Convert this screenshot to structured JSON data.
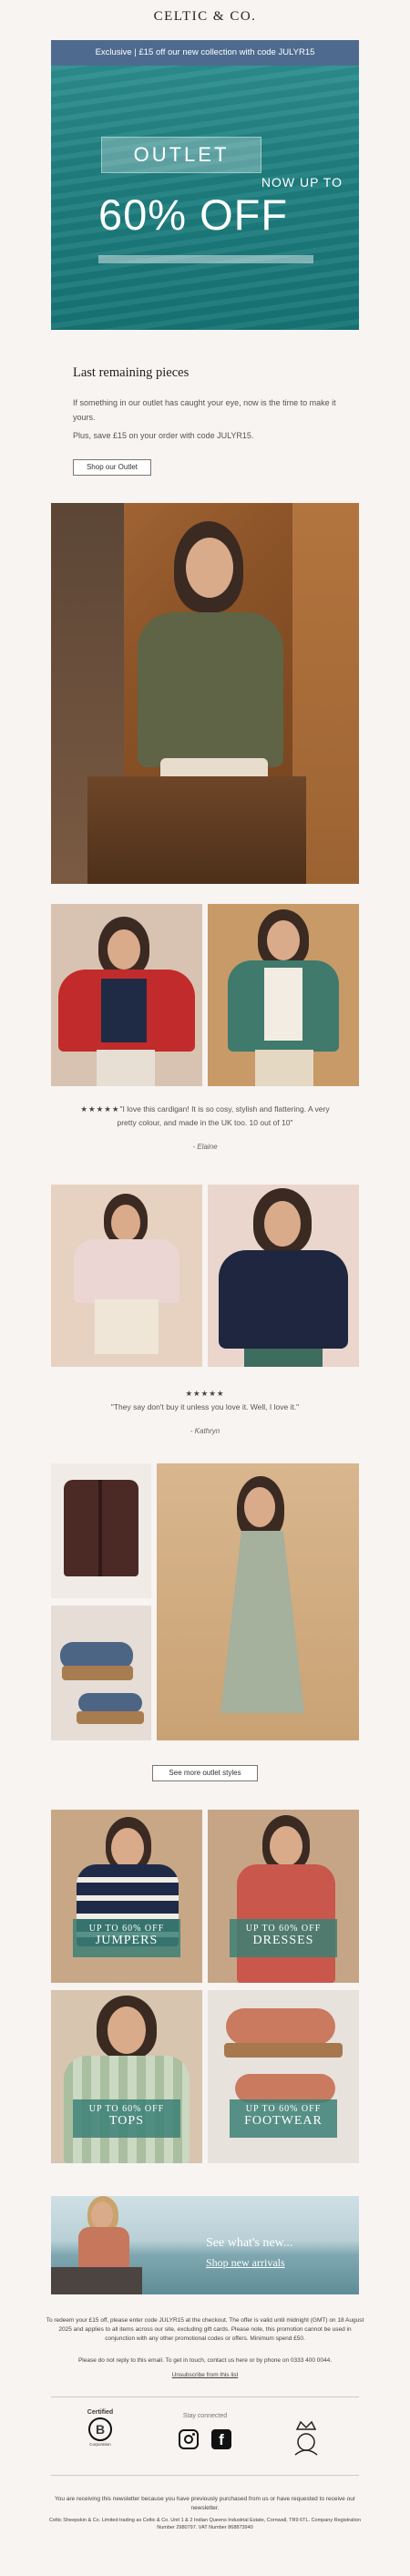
{
  "brand": {
    "logo": "CELTIC & CO."
  },
  "hero": {
    "banner": "Exclusive | £15 off our new collection with code JULYR15",
    "outlet": "OUTLET",
    "now_up_to": "NOW UP TO",
    "percent": "60% OFF"
  },
  "intro": {
    "title": "Last remaining pieces",
    "p1": "If something in our outlet has caught your eye, now is the time to make it yours.",
    "p2": "Plus, save £15 on your order with code JULYR15.",
    "button": "Shop our Outlet"
  },
  "review1": {
    "stars": "★★★★★",
    "text": "\"I love this cardigan! It is so cosy, stylish and flattering. A very pretty colour, and made in the UK too. 10 out of 10\"",
    "author": "- Elaine"
  },
  "review2": {
    "stars": "★★★★★",
    "text": "\"They say don't buy it unless you love it. Well, I love it.\"",
    "author": "- Kathryn"
  },
  "more_button": "See more outlet styles",
  "categories": [
    {
      "line1": "UP TO 60% OFF",
      "line2": "JUMPERS"
    },
    {
      "line1": "UP TO 60% OFF",
      "line2": "DRESSES"
    },
    {
      "line1": "UP TO 60% OFF",
      "line2": "TOPS"
    },
    {
      "line1": "UP TO 60% OFF",
      "line2": "FOOTWEAR"
    }
  ],
  "new_banner": {
    "line1": "See what's new...",
    "line2": "Shop new arrivals"
  },
  "footer": {
    "terms": "To redeem your £15 off, please enter code JULYR15 at the checkout. The offer is valid until midnight (GMT) on 18 August 2025 and applies to all items across our site, excluding gift cards. Please note, this promotion cannot be used in conjunction with any other promotional codes or offers. Minimum spend £50.",
    "reply": "Please do not reply to this email. To get in touch, contact us here or by phone on 0333 400 0044.",
    "unsubscribe": "Unsubscribe from this list",
    "certified_label": "Certified",
    "certified_sub": "Corporation",
    "stay_connected": "Stay connected",
    "receiving": "You are receiving this newsletter because you have previously purchased from us or have requested to receive our newsletter.",
    "legal": "Celtic Sheepskin & Co. Limited trading as Celtic & Co. Unit 1 & 2 Indian Queens Industrial Estate, Cornwall, TR9 6TL. Company Registration Number 2980797. VAT Number 868873940"
  }
}
